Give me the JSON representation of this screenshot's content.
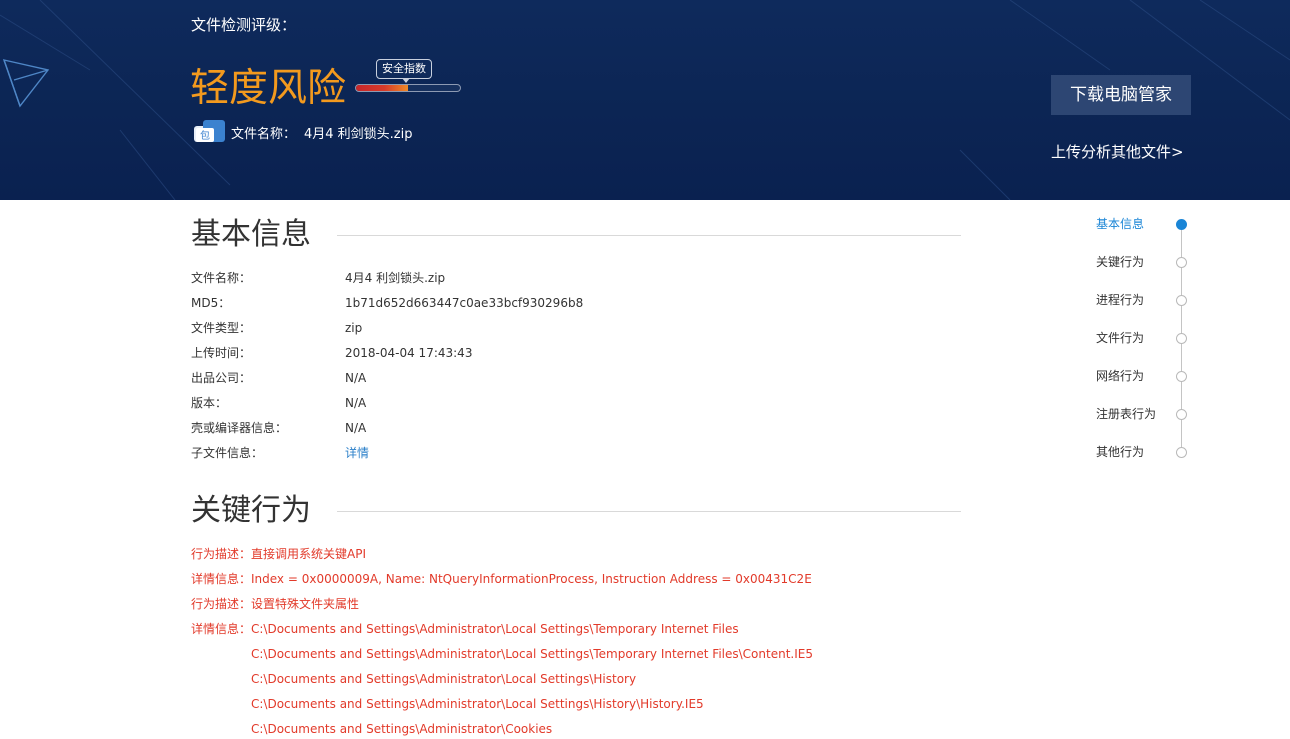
{
  "header": {
    "rating_label": "文件检测评级：",
    "risk_level": "轻度风险",
    "risk_color": "#f39a1e",
    "gauge": {
      "tooltip": "安全指数",
      "fill_fraction": 0.5
    },
    "file_icon": "archive-package-icon",
    "file_icon_glyph": "包",
    "file_name_label": "文件名称：",
    "file_name_value": "4月4 利剑锁头.zip",
    "download_button": "下载电脑管家",
    "upload_link": "上传分析其他文件>"
  },
  "basic_info": {
    "title": "基本信息",
    "rows": [
      {
        "label": "文件名称：",
        "value": "4月4 利剑锁头.zip"
      },
      {
        "label": "MD5：",
        "value": "1b71d652d663447c0ae33bcf930296b8"
      },
      {
        "label": "文件类型：",
        "value": "zip"
      },
      {
        "label": "上传时间：",
        "value": "2018-04-04 17:43:43"
      },
      {
        "label": "出品公司：",
        "value": "N/A"
      },
      {
        "label": "版本：",
        "value": "N/A"
      },
      {
        "label": "壳或编译器信息：",
        "value": "N/A"
      },
      {
        "label": "子文件信息：",
        "value": "详情"
      }
    ]
  },
  "key_behaviors": {
    "title": "关键行为",
    "color": "#e23a2a",
    "lines": [
      "行为描述：直接调用系统关键API",
      "详情信息：Index = 0x0000009A, Name: NtQueryInformationProcess, Instruction Address = 0x00431C2E",
      "行为描述：设置特殊文件夹属性",
      "详情信息：C:\\Documents and Settings\\Administrator\\Local Settings\\Temporary Internet Files",
      "C:\\Documents and Settings\\Administrator\\Local Settings\\Temporary Internet Files\\Content.IE5",
      "C:\\Documents and Settings\\Administrator\\Local Settings\\History",
      "C:\\Documents and Settings\\Administrator\\Local Settings\\History\\History.IE5",
      "C:\\Documents and Settings\\Administrator\\Cookies"
    ]
  },
  "side_nav": {
    "active_color": "#1a85d6",
    "items": [
      {
        "label": "基本信息",
        "active": true
      },
      {
        "label": "关键行为",
        "active": false
      },
      {
        "label": "进程行为",
        "active": false
      },
      {
        "label": "文件行为",
        "active": false
      },
      {
        "label": "网络行为",
        "active": false
      },
      {
        "label": "注册表行为",
        "active": false
      },
      {
        "label": "其他行为",
        "active": false
      }
    ]
  }
}
